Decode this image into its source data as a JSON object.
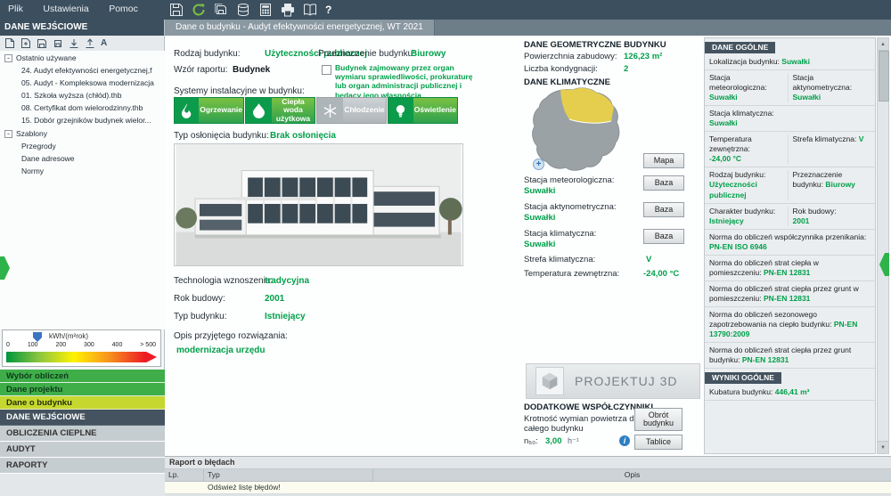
{
  "menu": {
    "items": [
      "Plik",
      "Ustawienia",
      "Pomoc"
    ]
  },
  "glyphs": {
    "collapse": "-",
    "scroll_up": "▲",
    "scroll_down": "▼",
    "zoom_plus": "+",
    "info": "i",
    "help": "?"
  },
  "icons": {
    "topbar": [
      "save-icon",
      "refresh-icon",
      "save-all-icon",
      "database-icon",
      "calculator-icon",
      "printer-icon",
      "manual-icon",
      "help-icon"
    ],
    "sidebar_toolbar": [
      "new-doc-icon",
      "add-doc-icon",
      "save-doc-icon",
      "import-icon",
      "export-icon",
      "sort-icon",
      "font-icon"
    ],
    "systems": [
      "flame-icon",
      "water-drop-icon",
      "snowflake-icon",
      "bulb-icon"
    ]
  },
  "sidebar": {
    "title": "DANE WEJŚCIOWE",
    "recent_label": "Ostatnio używane",
    "recent_items": [
      "24. Audyt efektywności energetycznej,f",
      "05. Audyt - Kompleksowa modernizacja",
      "01. Szkoła wyższa (chłód).thb",
      "08. Certyfikat dom wielorodzinny.thb",
      "15. Dobór grzejników budynek wielor..."
    ],
    "templates_label": "Szablony",
    "template_items": [
      "Przegrody",
      "Dane adresowe",
      "Normy"
    ],
    "scale_unit": "kWh/(m²rok)",
    "scale_ticks": [
      "0",
      "100",
      "200",
      "300",
      "400",
      "> 500"
    ],
    "nav": [
      "Wybór obliczeń",
      "Dane projektu",
      "Dane o budynku",
      "DANE WEJŚCIOWE",
      "OBLICZENIA CIEPLNE",
      "AUDYT",
      "RAPORTY"
    ]
  },
  "tab_title": "Dane o budynku - Audyt efektywności energetycznej, WT 2021",
  "form": {
    "rodzaj_label": "Rodzaj budynku:",
    "rodzaj_value": "Użyteczności publicznej",
    "wzor_label": "Wzór raportu:",
    "wzor_value": "Budynek",
    "przezn_label": "Przeznaczenie budynku:",
    "przezn_value": "Biurowy",
    "checkbox_text": "Budynek zajmowany przez organ wymiaru sprawiedliwości, prokuraturę lub organ administracji publicznej i będący jego własnością",
    "systems_label": "Systemy instalacyjne w budynku:",
    "systems": [
      {
        "label": "Ogrzewanie"
      },
      {
        "label": "Ciepła woda użytkowa"
      },
      {
        "label": "Chłodzenie"
      },
      {
        "label": "Oświetlenie"
      }
    ],
    "oslona_label": "Typ osłonięcia budynku:",
    "oslona_value": "Brak osłonięcia",
    "tech_label": "Technologia wznoszenia:",
    "tech_value": "tradycyjna",
    "rok_label": "Rok budowy:",
    "rok_value": "2001",
    "typ_label": "Typ budynku:",
    "typ_value": "Istniejący",
    "opis_label": "Opis przyjętego rozwiązania:",
    "opis_value": "modernizacja urzędu"
  },
  "geometry": {
    "title": "DANE GEOMETRYCZNE BUDYNKU",
    "area_label": "Powierzchnia zabudowy:",
    "area_value": "126,23 m²",
    "floors_label": "Liczba kondygnacji:",
    "floors_value": "2"
  },
  "climate": {
    "title": "DANE KLIMATYCZNE",
    "map_button": "Mapa",
    "baza_button": "Baza",
    "meteo_label": "Stacja meteorologiczna:",
    "meteo_value": "Suwałki",
    "aktyno_label": "Stacja aktynometryczna:",
    "aktyno_value": "Suwałki",
    "klimat_label": "Stacja klimatyczna:",
    "klimat_value": "Suwałki",
    "strefa_label": "Strefa klimatyczna:",
    "strefa_value": "V",
    "temp_label": "Temperatura zewnętrzna:",
    "temp_value": "-24,00 °C"
  },
  "project3d_label": "PROJEKTUJ 3D",
  "coeff": {
    "title": "DODATKOWE WSPÓŁCZYNNIKI",
    "desc": "Krotność wymian powietrza dla całego budynku",
    "n_label": "n₅₀:",
    "n_value": "3,00",
    "n_unit": "h⁻¹",
    "rotate_button": "Obrót budynku",
    "tables_button": "Tablice"
  },
  "panel": {
    "title": "DANE OGÓLNE",
    "loc_label": "Lokalizacja budynku:",
    "loc_value": "Suwałki",
    "meteo_label": "Stacja meteorologiczna:",
    "meteo_value": "Suwałki",
    "aktyno_label": "Stacja aktynometryczna:",
    "aktyno_value": "Suwałki",
    "klimat_label": "Stacja klimatyczna:",
    "klimat_value": "Suwałki",
    "temp_label": "Temperatura zewnętrzna:",
    "temp_value": "-24,00 °C",
    "strefa_label": "Strefa klimatyczna:",
    "strefa_value": "V",
    "rodzaj_label": "Rodzaj budynku:",
    "rodzaj_value": "Użyteczności publicznej",
    "przezn_label": "Przeznaczenie budynku:",
    "przezn_value": "Biurowy",
    "charakter_label": "Charakter budynku:",
    "charakter_value": "Istniejący",
    "rok_label": "Rok budowy:",
    "rok_value": "2001",
    "norms": [
      {
        "label": "Norma do obliczeń współczynnika przenikania:",
        "value": "PN-EN ISO 6946"
      },
      {
        "label": "Norma do obliczeń strat ciepła w pomieszczeniu:",
        "value": "PN-EN 12831"
      },
      {
        "label": "Norma do obliczeń strat ciepła przez grunt w pomieszczeniu:",
        "value": "PN-EN 12831"
      },
      {
        "label": "Norma do obliczeń sezonowego zapotrzebowania na ciepło budynku:",
        "value": "PN-EN 13790:2009"
      },
      {
        "label": "Norma do obliczeń strat ciepła przez grunt budynku:",
        "value": "PN-EN 12831"
      }
    ],
    "results_title": "WYNIKI OGÓLNE",
    "kubatura_label": "Kubatura budynku:",
    "kubatura_value": "446,41 m³"
  },
  "errors": {
    "title": "Raport o błędach",
    "col_lp": "Lp.",
    "col_typ": "Typ",
    "col_opis": "Opis",
    "refresh_row": "Odśwież listę błędów!"
  }
}
